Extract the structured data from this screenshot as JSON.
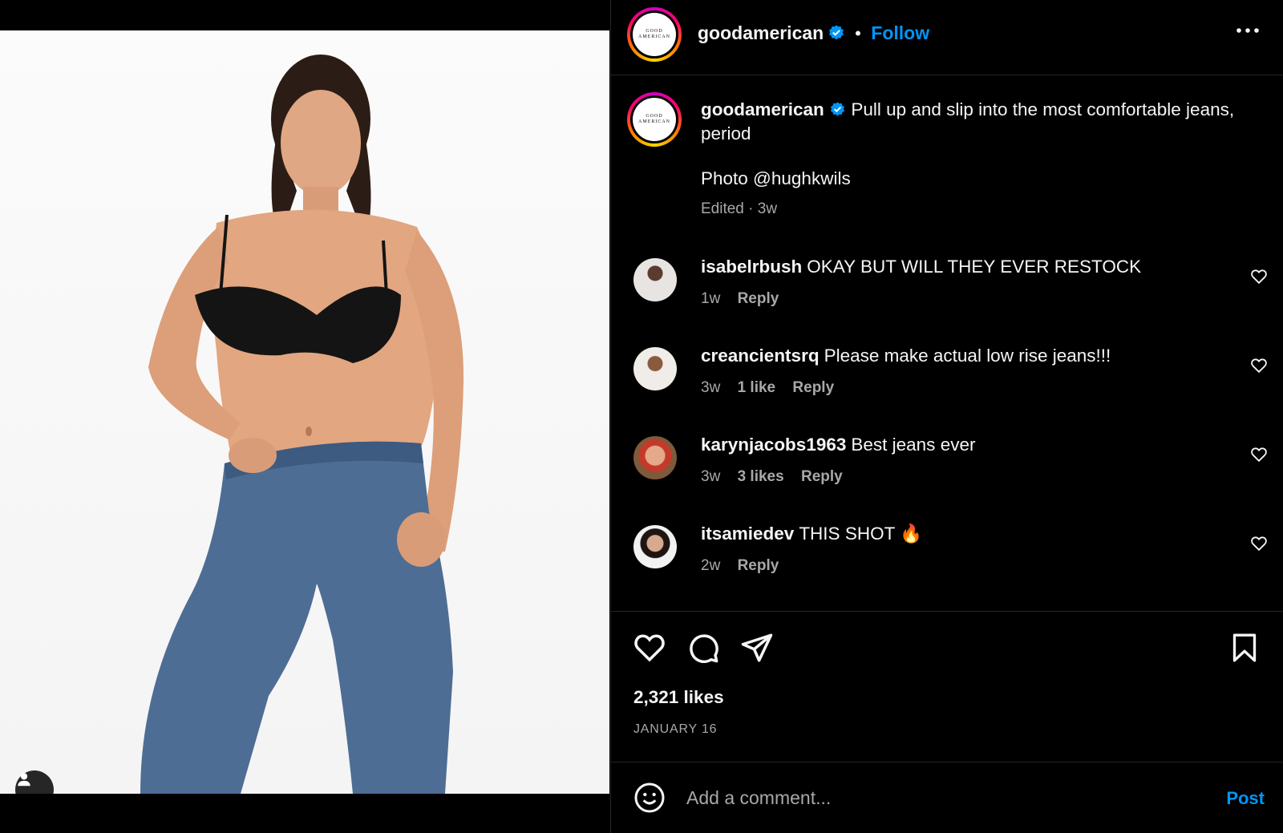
{
  "post": {
    "author": "goodamerican",
    "logo_top": "GOOD",
    "logo_bottom": "AMERICAN",
    "follow_label": "Follow",
    "separator": "•"
  },
  "caption": {
    "username": "goodamerican",
    "text": "Pull up and slip into the most comfortable jeans, period",
    "photo_credit": "Photo @hughkwils",
    "meta": "Edited · 3w"
  },
  "comments": [
    {
      "username": "isabelrbush",
      "text": "OKAY BUT WILL THEY EVER RESTOCK",
      "time": "1w",
      "likes": "",
      "reply": "Reply"
    },
    {
      "username": "creancientsrq",
      "text": "Please make actual low rise jeans!!!",
      "time": "3w",
      "likes": "1 like",
      "reply": "Reply"
    },
    {
      "username": "karynjacobs1963",
      "text": "Best jeans ever",
      "time": "3w",
      "likes": "3 likes",
      "reply": "Reply"
    },
    {
      "username": "itsamiedev",
      "text": "THIS SHOT 🔥",
      "time": "2w",
      "likes": "",
      "reply": "Reply"
    }
  ],
  "stats": {
    "likes": "2,321 likes",
    "date": "JANUARY 16"
  },
  "composer": {
    "placeholder": "Add a comment...",
    "post_label": "Post"
  },
  "icons": {
    "like": "heart-icon",
    "comment": "comment-bubble-icon",
    "share": "paper-plane-icon",
    "save": "bookmark-icon",
    "emoji": "smiley-icon",
    "more": "more-horizontal-icon",
    "tagged": "user-tag-icon",
    "verified": "verified-badge-icon"
  },
  "colors": {
    "accent": "#0095f6",
    "background": "#000000",
    "muted": "#a8a8a8",
    "verified": "#0095f6"
  }
}
